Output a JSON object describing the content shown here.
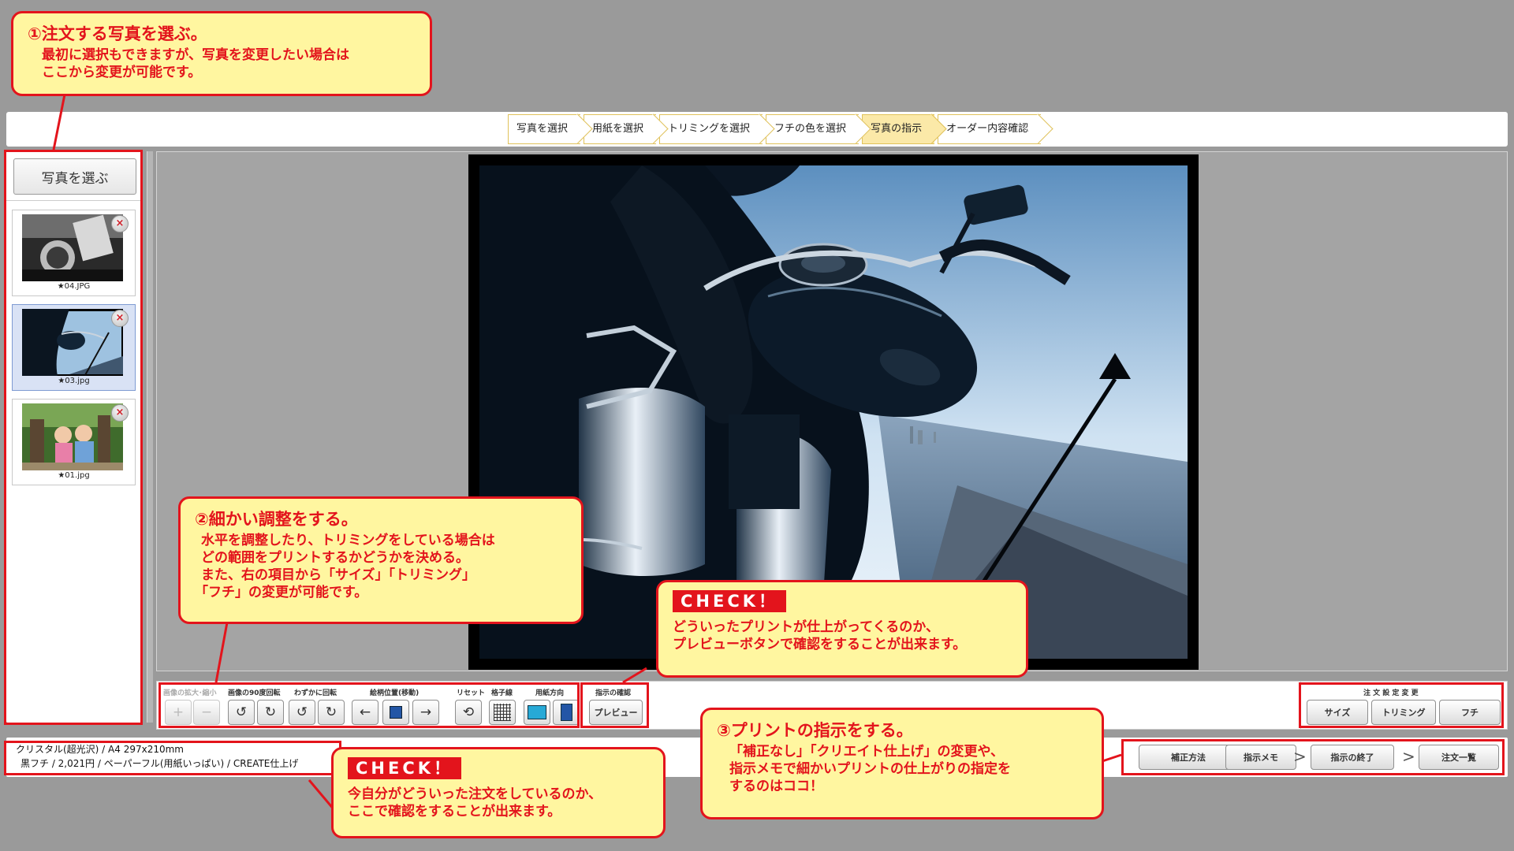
{
  "steps": [
    {
      "label": "写真を選択",
      "active": false
    },
    {
      "label": "用紙を選択",
      "active": false
    },
    {
      "label": "トリミングを選択",
      "active": false
    },
    {
      "label": "フチの色を選択",
      "active": false
    },
    {
      "label": "写真の指示",
      "active": true
    },
    {
      "label": "オーダー内容確認",
      "active": false
    }
  ],
  "sidebar": {
    "choose_button": "写真を選ぶ",
    "photos": [
      {
        "label": "★04.JPG",
        "selected": false,
        "delete_icon": "×"
      },
      {
        "label": "★03.jpg",
        "selected": true,
        "delete_icon": "×"
      },
      {
        "label": "★01.jpg",
        "selected": false,
        "delete_icon": "×"
      }
    ]
  },
  "toolbar": {
    "zoom_label": "画像の拡大･縮小",
    "rotate90_label": "画像の90度回転",
    "fine_rotate_label": "わずかに回転",
    "position_label": "絵柄位置(移動)",
    "reset_label": "リセット",
    "grid_label": "格子線",
    "orientation_label": "用紙方向",
    "preview_group_label": "指示の確認",
    "preview_button": "プレビュー",
    "order_change_label": "注 文 設 定 変 更",
    "size_button": "サイズ",
    "trimming_button": "トリミング",
    "border_button": "フチ",
    "icons": {
      "zoom_in": "+",
      "zoom_out": "−",
      "rotate_left": "↺",
      "rotate_right": "↻",
      "fine_left": "↺",
      "fine_right": "↻",
      "move_left": "←",
      "move_right": "→",
      "reset": "⟲"
    }
  },
  "bottom": {
    "order_line1": "クリスタル(超光沢) / A4  297x210mm",
    "order_line2": "黒フチ / 2,021円 / ペーパーフル(用紙いっぱい) / CREATE仕上げ",
    "correction_button": "補正方法",
    "memo_button": "指示メモ",
    "finish_button": "指示の終了",
    "order_list_button": "注文一覧",
    "chevron": ">"
  },
  "callouts": {
    "c1_title": "①注文する写真を選ぶ。",
    "c1_line1": "最初に選択もできますが、写真を変更したい場合は",
    "c1_line2": "ここから変更が可能です。",
    "c2_title": "②細かい調整をする。",
    "c2_line1": "水平を調整したり、トリミングをしている場合は",
    "c2_line2": "どの範囲をプリントするかどうかを決める。",
    "c2_line3": "また、右の項目から「サイズ」「トリミング」",
    "c2_line4": "「フチ」の変更が可能です。",
    "c3_title": "③プリントの指示をする。",
    "c3_line1": "「補正なし」「クリエイト仕上げ」の変更や、",
    "c3_line2": "指示メモで細かいプリントの仕上がりの指定を",
    "c3_line3": "するのはココ！",
    "check_tag": "CHECK！",
    "check1_line1": "どういったプリントが仕上がってくるのか、",
    "check1_line2": "プレビューボタンで確認をすることが出来ます。",
    "check2_line1": "今自分がどういった注文をしているのか、",
    "check2_line2": "ここで確認をすることが出来ます。"
  }
}
